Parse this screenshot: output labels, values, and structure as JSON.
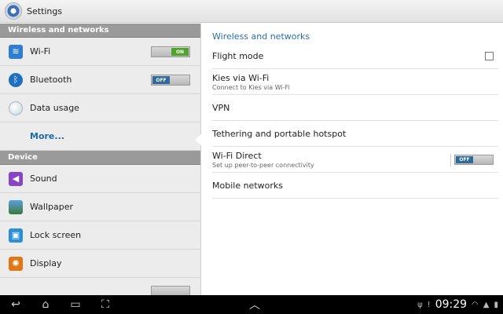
{
  "titlebar": {
    "title": "Settings"
  },
  "left": {
    "section1": "Wireless and networks",
    "wifi": {
      "label": "Wi-Fi",
      "toggle": "ON"
    },
    "bluetooth": {
      "label": "Bluetooth",
      "toggle": "OFF"
    },
    "data_usage": {
      "label": "Data usage"
    },
    "more": {
      "label": "More..."
    },
    "section2": "Device",
    "sound": {
      "label": "Sound"
    },
    "wallpaper": {
      "label": "Wallpaper"
    },
    "lock_screen": {
      "label": "Lock screen"
    },
    "display": {
      "label": "Display"
    }
  },
  "right": {
    "header": "Wireless and networks",
    "flight_mode": {
      "label": "Flight mode",
      "checked": false
    },
    "kies": {
      "label": "Kies via Wi-Fi",
      "sub": "Connect to Kies via Wi-Fi"
    },
    "vpn": {
      "label": "VPN"
    },
    "tethering": {
      "label": "Tethering and portable hotspot"
    },
    "wifi_direct": {
      "label": "Wi-Fi Direct",
      "sub": "Set up peer-to-peer connectivity",
      "toggle": "OFF"
    },
    "mobile_networks": {
      "label": "Mobile networks"
    }
  },
  "navbar": {
    "back_icon": "↩",
    "home_icon": "⌂",
    "recent_icon": "▭",
    "screenshot_icon": "⛶",
    "up_icon": "︿",
    "usb_icon": "ψ",
    "notify_icon": "!",
    "wifi_icon": "◠",
    "signal_icon": "▲",
    "battery_icon": "▮",
    "clock": "09:29"
  },
  "colors": {
    "accent": "#2a6fa5",
    "toggle_on": "#4ea52a",
    "toggle_off": "#2f6a9c"
  }
}
